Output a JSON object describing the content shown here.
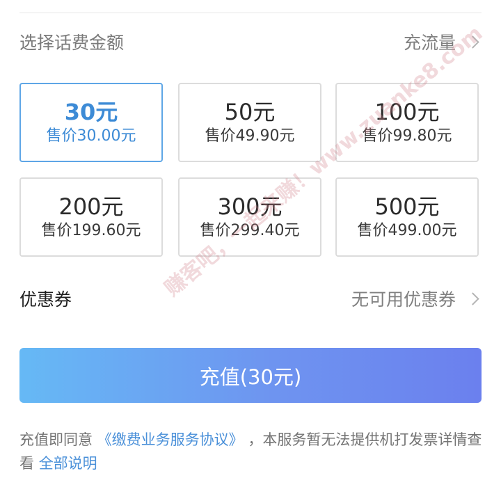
{
  "header": {
    "title": "选择话费金额",
    "data_link": "充流量"
  },
  "cards": [
    {
      "amount": "30元",
      "price": "售价30.00元",
      "selected": true
    },
    {
      "amount": "50元",
      "price": "售价49.90元",
      "selected": false
    },
    {
      "amount": "100元",
      "price": "售价99.80元",
      "selected": false
    },
    {
      "amount": "200元",
      "price": "售价199.60元",
      "selected": false
    },
    {
      "amount": "300元",
      "price": "售价299.40元",
      "selected": false
    },
    {
      "amount": "500元",
      "price": "售价499.00元",
      "selected": false
    }
  ],
  "coupon": {
    "label": "优惠券",
    "value": "无可用优惠券"
  },
  "recharge_button": "充值(30元)",
  "agreement": {
    "prefix": "充值即同意",
    "agreement_link": "《缴费业务服务协议》",
    "middle": "，本服务暂无法提供机打发票详情查看",
    "details_link": "全部说明"
  },
  "watermark": "赚客吧，一起来赚！www.zuanke8.com",
  "colors": {
    "accent": "#3d8bd6",
    "button_start": "#66b9f5",
    "button_end": "#6b80ee"
  }
}
